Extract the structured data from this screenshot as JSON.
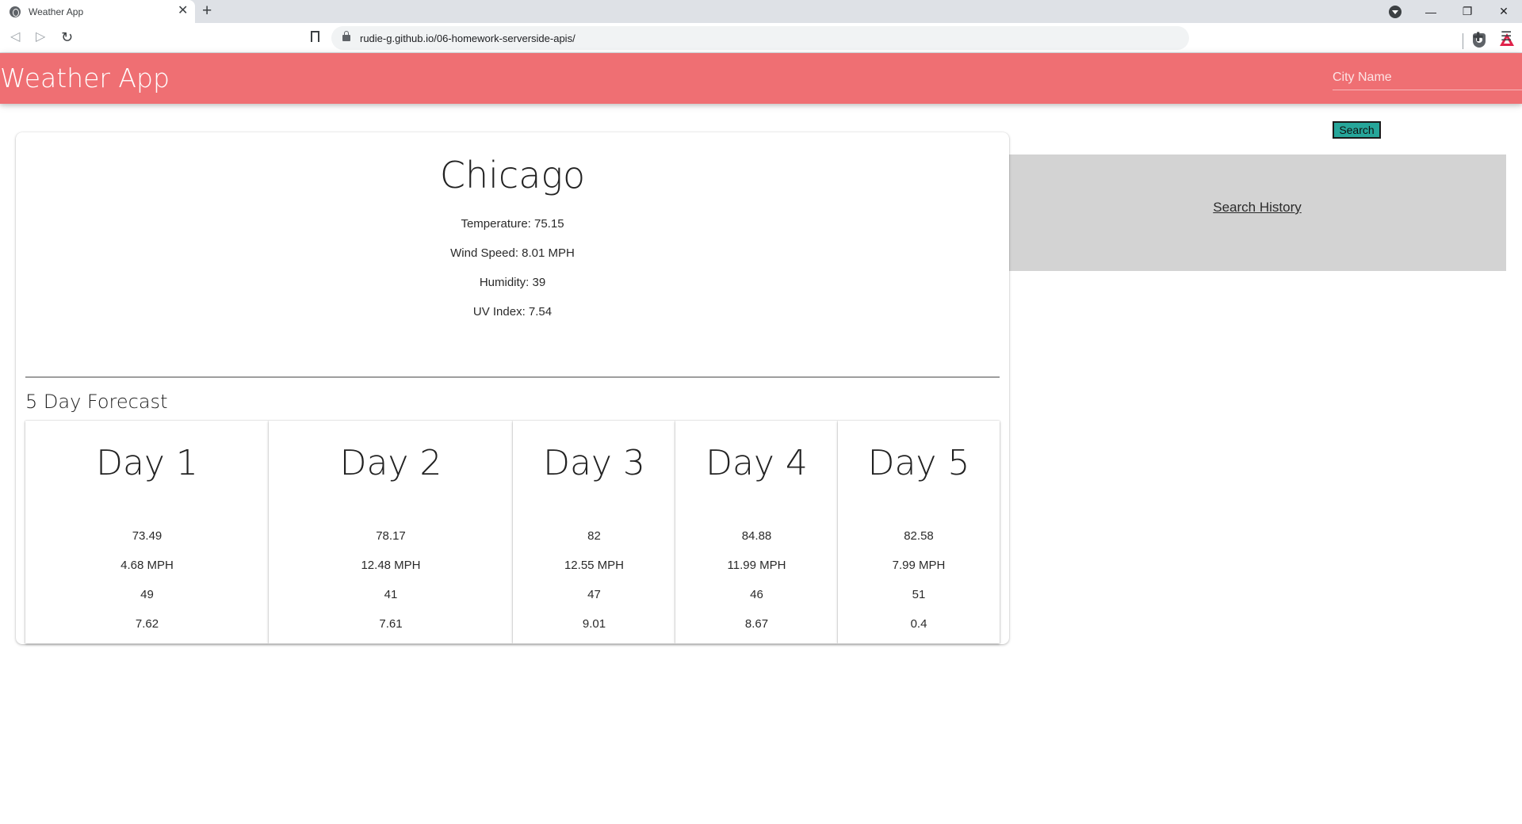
{
  "browser": {
    "tab_title": "Weather App",
    "url": "rudie-g.github.io/06-homework-serverside-apis/"
  },
  "navbar": {
    "brand": "Weather App",
    "city_placeholder": "City Name",
    "color": "#ef6f73"
  },
  "search": {
    "button_label": "Search",
    "button_color": "#26a69a"
  },
  "history": {
    "label": "Search History"
  },
  "current": {
    "city": "Chicago",
    "temperature": "Temperature: 75.15",
    "wind_speed": "Wind Speed: 8.01 MPH",
    "humidity": "Humidity: 39",
    "uv_index": "UV Index: 7.54"
  },
  "forecast": {
    "heading": "5 Day Forecast",
    "days": [
      {
        "title": "Day 1",
        "temp": "73.49",
        "wind": "4.68 MPH",
        "humidity": "49",
        "uv": "7.62"
      },
      {
        "title": "Day 2",
        "temp": "78.17",
        "wind": "12.48 MPH",
        "humidity": "41",
        "uv": "7.61"
      },
      {
        "title": "Day 3",
        "temp": "82",
        "wind": "12.55 MPH",
        "humidity": "47",
        "uv": "9.01"
      },
      {
        "title": "Day 4",
        "temp": "84.88",
        "wind": "11.99 MPH",
        "humidity": "46",
        "uv": "8.67"
      },
      {
        "title": "Day 5",
        "temp": "82.58",
        "wind": "7.99 MPH",
        "humidity": "51",
        "uv": "0.4"
      }
    ]
  }
}
